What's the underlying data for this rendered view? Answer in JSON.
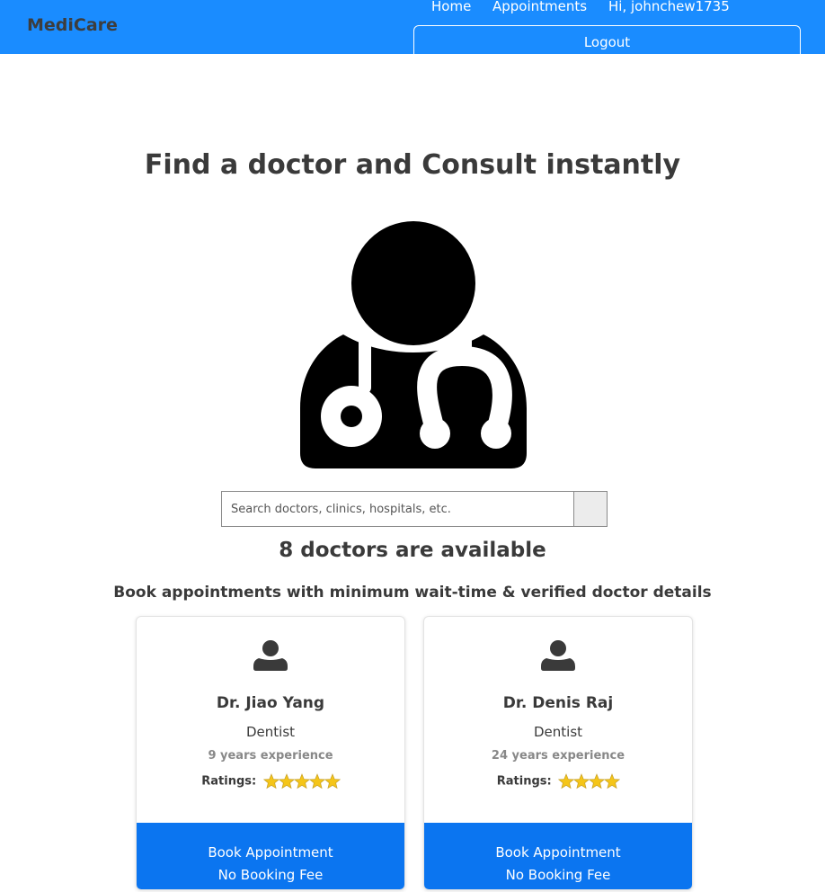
{
  "nav": {
    "brand": "MediCare",
    "home": "Home",
    "appointments": "Appointments",
    "greeting": "Hi, johnchew1735",
    "logout": "Logout"
  },
  "hero": {
    "title": "Find a doctor and Consult instantly"
  },
  "search": {
    "placeholder": "Search doctors, clinics, hospitals, etc."
  },
  "results": {
    "count_text": "8 doctors are available",
    "subtitle": "Book appointments with minimum wait-time & verified doctor details"
  },
  "doctors": [
    {
      "name": "Dr. Jiao Yang",
      "specialty": "Dentist",
      "experience": "9 years experience",
      "ratings_label": "Ratings:",
      "rating_stars": 5,
      "book_label": "Book Appointment",
      "fee_label": "No Booking Fee"
    },
    {
      "name": "Dr. Denis Raj",
      "specialty": "Dentist",
      "experience": "24 years experience",
      "ratings_label": "Ratings:",
      "rating_stars": 4,
      "book_label": "Book Appointment",
      "fee_label": "No Booking Fee"
    }
  ],
  "colors": {
    "navbar": "#1a8cff",
    "book_button": "#0b75f0",
    "star": "#f5c518"
  },
  "icons": {
    "hero": "doctor-icon",
    "avatar": "user-icon",
    "rating": "star-icon",
    "search": "search-icon"
  }
}
